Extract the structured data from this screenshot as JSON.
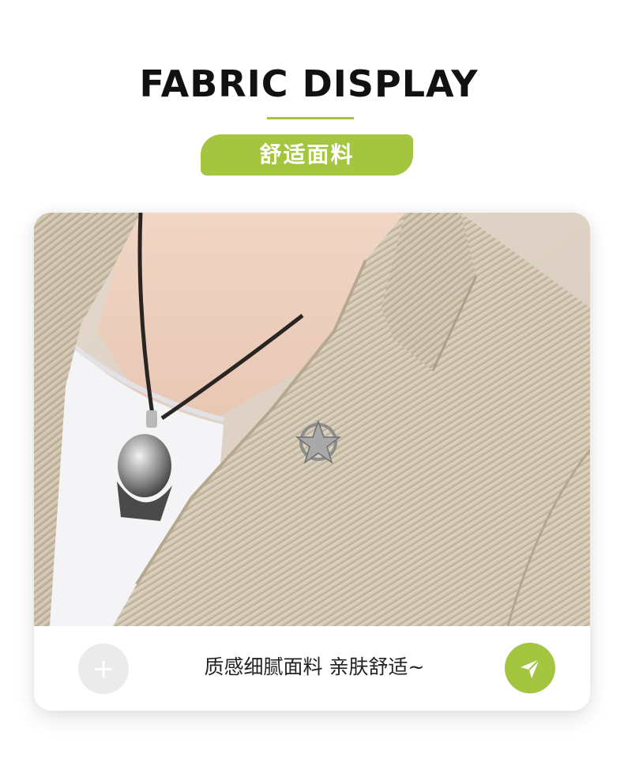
{
  "header": {
    "title": "FABRIC DISPLAY",
    "subtitle": "舒适面料"
  },
  "card": {
    "caption": "质感细腻面料 亲肤舒适~",
    "add_icon": "plus-icon",
    "send_icon": "paper-plane-icon"
  },
  "colors": {
    "accent": "#a3c540",
    "title": "#111111",
    "add_button_bg": "#ebebeb",
    "fabric": "#d3c8b4"
  }
}
